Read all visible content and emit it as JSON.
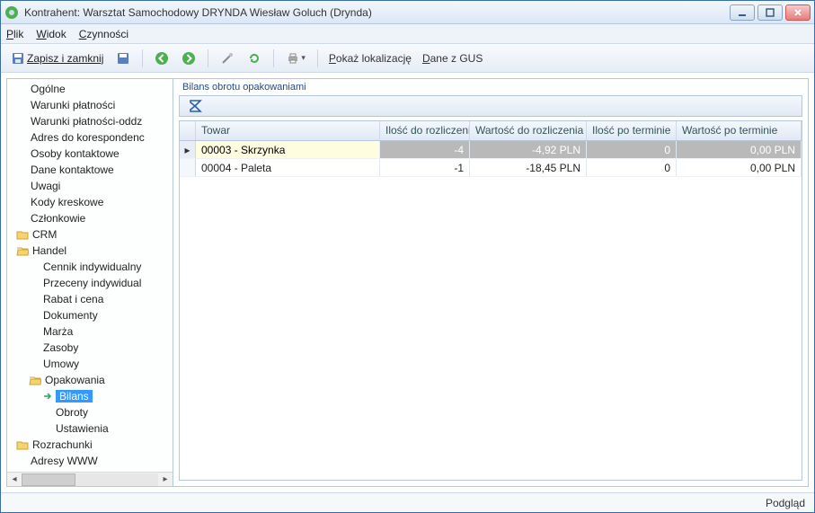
{
  "title": "Kontrahent: Warsztat Samochodowy DRYNDA Wiesław Goluch (Drynda)",
  "menu": {
    "plik": "Plik",
    "widok": "Widok",
    "czynnosci": "Czynności"
  },
  "toolbar": {
    "save_close": "Zapisz i zamknij",
    "pokaz_lokalizacje": "Pokaż lokalizację",
    "dane_zgus": "Dane z GUS"
  },
  "sidebar": {
    "ogolne": "Ogólne",
    "warunki_plat": "Warunki płatności",
    "warunki_plat_oddz": "Warunki płatności-oddziały",
    "adres_koresp": "Adres do korespondencji",
    "osoby_kontakt": "Osoby kontaktowe",
    "dane_kontakt": "Dane kontaktowe",
    "uwagi": "Uwagi",
    "kody_kresk": "Kody kreskowe",
    "czlonkowie": "Członkowie",
    "crm": "CRM",
    "handel": "Handel",
    "cennik_ind": "Cennik indywidualny",
    "przeceny_ind": "Przeceny indywidualne",
    "rabat_cena": "Rabat i cena",
    "dokumenty": "Dokumenty",
    "marza": "Marża",
    "zasoby": "Zasoby",
    "umowy": "Umowy",
    "opakowania": "Opakowania",
    "bilans": "Bilans",
    "obroty": "Obroty",
    "ustawienia": "Ustawienia",
    "rozrachunki": "Rozrachunki",
    "adresy_www": "Adresy WWW"
  },
  "main": {
    "group_title": "Bilans obrotu opakowaniami",
    "columns": {
      "towar": "Towar",
      "ilosc_rozl": "Ilość do rozliczenia",
      "wartosc_rozl": "Wartość do rozliczenia",
      "ilosc_term": "Ilość po terminie",
      "wartosc_term": "Wartość po terminie"
    },
    "rows": [
      {
        "towar": "00003 - Skrzynka",
        "ir": "-4",
        "wr": "-4,92 PLN",
        "it": "0",
        "wt": "0,00 PLN"
      },
      {
        "towar": "00004 - Paleta",
        "ir": "-1",
        "wr": "-18,45 PLN",
        "it": "0",
        "wt": "0,00 PLN"
      }
    ]
  },
  "status": {
    "podglad": "Podgląd"
  }
}
